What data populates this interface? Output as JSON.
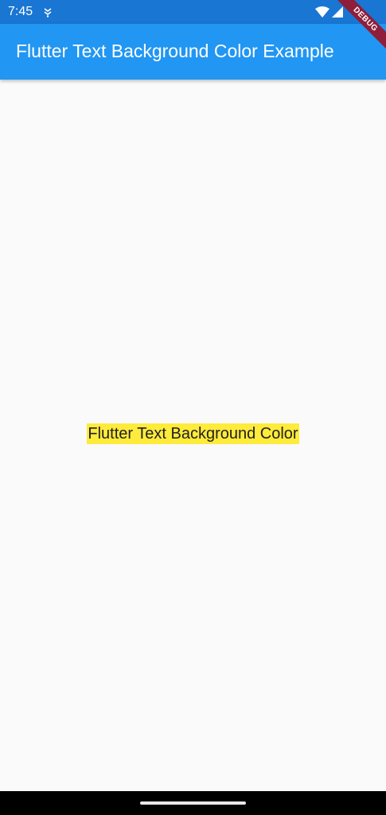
{
  "status_bar": {
    "time": "7:45",
    "icons": [
      "notification-icon",
      "wifi-icon",
      "signal-icon"
    ]
  },
  "app_bar": {
    "title": "Flutter Text Background Color Example"
  },
  "debug_banner": {
    "label": "DEBUG"
  },
  "main": {
    "text": "Flutter Text Background Color"
  },
  "colors": {
    "status_bar": "#1976d2",
    "app_bar": "#2196f3",
    "text_background": "#ffeb3b",
    "page_background": "#fafafa",
    "debug_banner": "#8e1e3a"
  }
}
